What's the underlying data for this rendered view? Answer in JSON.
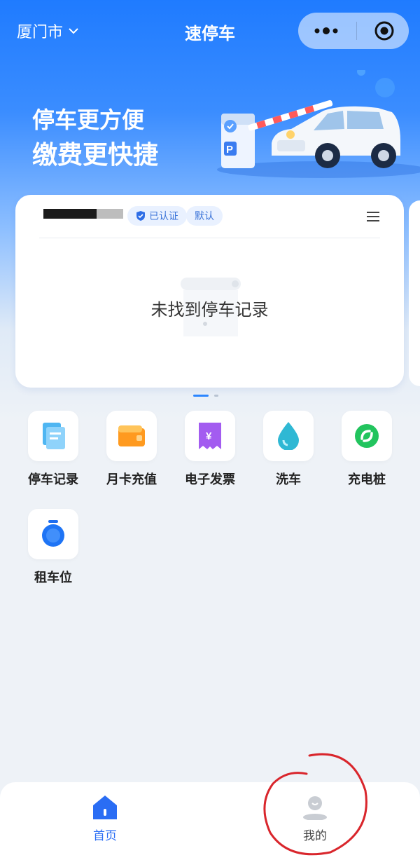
{
  "header": {
    "city": "厦门市",
    "title": "速停车"
  },
  "banner": {
    "line1": "停车更方便",
    "line2": "缴费更快捷"
  },
  "vehicle_card": {
    "verified_badge": "已认证",
    "default_badge": "默认",
    "empty_message": "未找到停车记录"
  },
  "services": [
    {
      "label": "停车记录",
      "icon": "parking-record-icon"
    },
    {
      "label": "月卡充值",
      "icon": "monthly-card-icon"
    },
    {
      "label": "电子发票",
      "icon": "invoice-icon"
    },
    {
      "label": "洗车",
      "icon": "car-wash-icon"
    },
    {
      "label": "充电桩",
      "icon": "charging-pile-icon"
    },
    {
      "label": "租车位",
      "icon": "rent-space-icon"
    }
  ],
  "tabbar": {
    "home": "首页",
    "mine": "我的"
  },
  "colors": {
    "accent": "#2c86ff",
    "tab_active": "#2a6df4",
    "annotation": "#d9262c"
  }
}
